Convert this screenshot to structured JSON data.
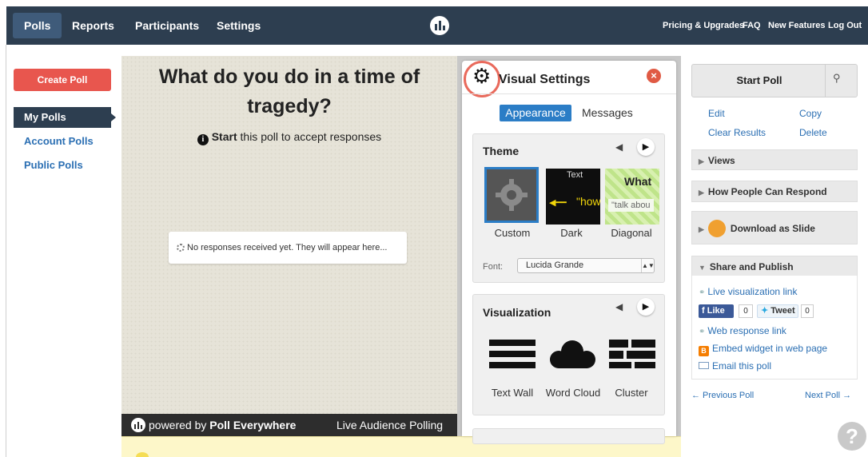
{
  "topnav": {
    "left": [
      "Polls",
      "Reports",
      "Participants",
      "Settings"
    ],
    "right": [
      "Pricing & Upgrades",
      "FAQ",
      "New Features",
      "Log Out"
    ]
  },
  "sidebar": {
    "create_label": "Create Poll",
    "items": [
      "My Polls",
      "Account Polls",
      "Public Polls"
    ]
  },
  "poll": {
    "title": "What do you do in a time of tragedy?",
    "hint_strong": "Start",
    "hint_rest": " this poll to accept responses",
    "no_responses": "No responses received yet. They will appear here..."
  },
  "footer": {
    "powered_prefix": "powered by ",
    "brand": "Poll Everywhere",
    "tagline": "Live Audience Polling"
  },
  "visual_settings": {
    "title": "Visual Settings",
    "tabs": [
      "Appearance",
      "Messages"
    ],
    "theme": {
      "heading": "Theme",
      "options": [
        "Custom",
        "Dark",
        "Diagonal"
      ],
      "dark_thumb_text": "Text",
      "dark_thumb_quote": "\"how",
      "diag_thumb_text": "What",
      "diag_thumb_quote": "\"talk abou",
      "font_label": "Font:",
      "font_value": "Lucida Grande"
    },
    "visualization": {
      "heading": "Visualization",
      "options": [
        "Text Wall",
        "Word Cloud",
        "Cluster"
      ]
    }
  },
  "right_panel": {
    "start_label": "Start Poll",
    "links": [
      "Edit",
      "Copy",
      "Clear Results",
      "Delete"
    ],
    "sections": [
      "Views",
      "How People Can Respond",
      "Download as Slide",
      "Share and Publish"
    ],
    "share": {
      "live_link": "Live visualization link",
      "like_label": "Like",
      "like_count": "0",
      "tweet_label": "Tweet",
      "tweet_count": "0",
      "web_link": "Web response link",
      "embed": "Embed widget in web page",
      "email": "Email this poll"
    },
    "prev": "← Previous Poll",
    "next": "Next Poll →"
  },
  "colors": {
    "nav": "#2d3e50",
    "create": "#e8564e",
    "accent": "#2b7dc6",
    "highlight_ring": "#e96a5c"
  }
}
